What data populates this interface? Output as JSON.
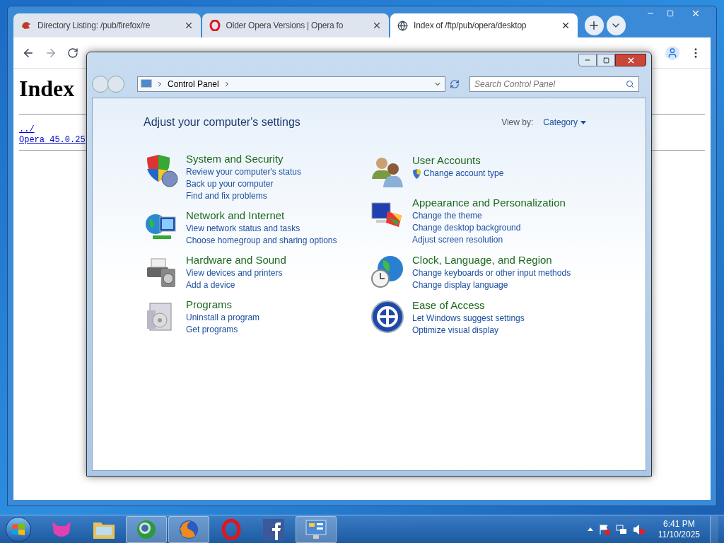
{
  "browser": {
    "tabs": [
      {
        "title": "Directory Listing: /pub/firefox/re",
        "selected": false
      },
      {
        "title": "Older Opera Versions | Opera fo",
        "selected": false
      },
      {
        "title": "Index of /ftp/pub/opera/desktop",
        "selected": true
      }
    ],
    "page": {
      "heading": "Index",
      "links": [
        "../",
        "Opera_45.0.25"
      ]
    }
  },
  "control_panel": {
    "breadcrumb": "Control Panel",
    "search": {
      "placeholder": "Search Control Panel"
    },
    "heading": "Adjust your computer's settings",
    "view_by": {
      "label": "View by:",
      "value": "Category"
    },
    "columns": [
      [
        {
          "title": "System and Security",
          "links": [
            {
              "text": "Review your computer's status",
              "shield": false
            },
            {
              "text": "Back up your computer",
              "shield": false
            },
            {
              "text": "Find and fix problems",
              "shield": false
            }
          ]
        },
        {
          "title": "Network and Internet",
          "links": [
            {
              "text": "View network status and tasks",
              "shield": false
            },
            {
              "text": "Choose homegroup and sharing options",
              "shield": false
            }
          ]
        },
        {
          "title": "Hardware and Sound",
          "links": [
            {
              "text": "View devices and printers",
              "shield": false
            },
            {
              "text": "Add a device",
              "shield": false
            }
          ]
        },
        {
          "title": "Programs",
          "links": [
            {
              "text": "Uninstall a program",
              "shield": false
            },
            {
              "text": "Get programs",
              "shield": false
            }
          ]
        }
      ],
      [
        {
          "title": "User Accounts",
          "links": [
            {
              "text": "Change account type",
              "shield": true
            }
          ]
        },
        {
          "title": "Appearance and Personalization",
          "links": [
            {
              "text": "Change the theme",
              "shield": false
            },
            {
              "text": "Change desktop background",
              "shield": false
            },
            {
              "text": "Adjust screen resolution",
              "shield": false
            }
          ]
        },
        {
          "title": "Clock, Language, and Region",
          "links": [
            {
              "text": "Change keyboards or other input methods",
              "shield": false
            },
            {
              "text": "Change display language",
              "shield": false
            }
          ]
        },
        {
          "title": "Ease of Access",
          "links": [
            {
              "text": "Let Windows suggest settings",
              "shield": false
            },
            {
              "text": "Optimize visual display",
              "shield": false
            }
          ]
        }
      ]
    ]
  },
  "taskbar": {
    "apps": [
      {
        "running": false
      },
      {
        "running": false
      },
      {
        "running": true
      },
      {
        "running": true
      },
      {
        "running": false
      },
      {
        "running": false
      },
      {
        "running": true
      }
    ],
    "time": "6:41 PM",
    "date": "11/10/2025"
  }
}
